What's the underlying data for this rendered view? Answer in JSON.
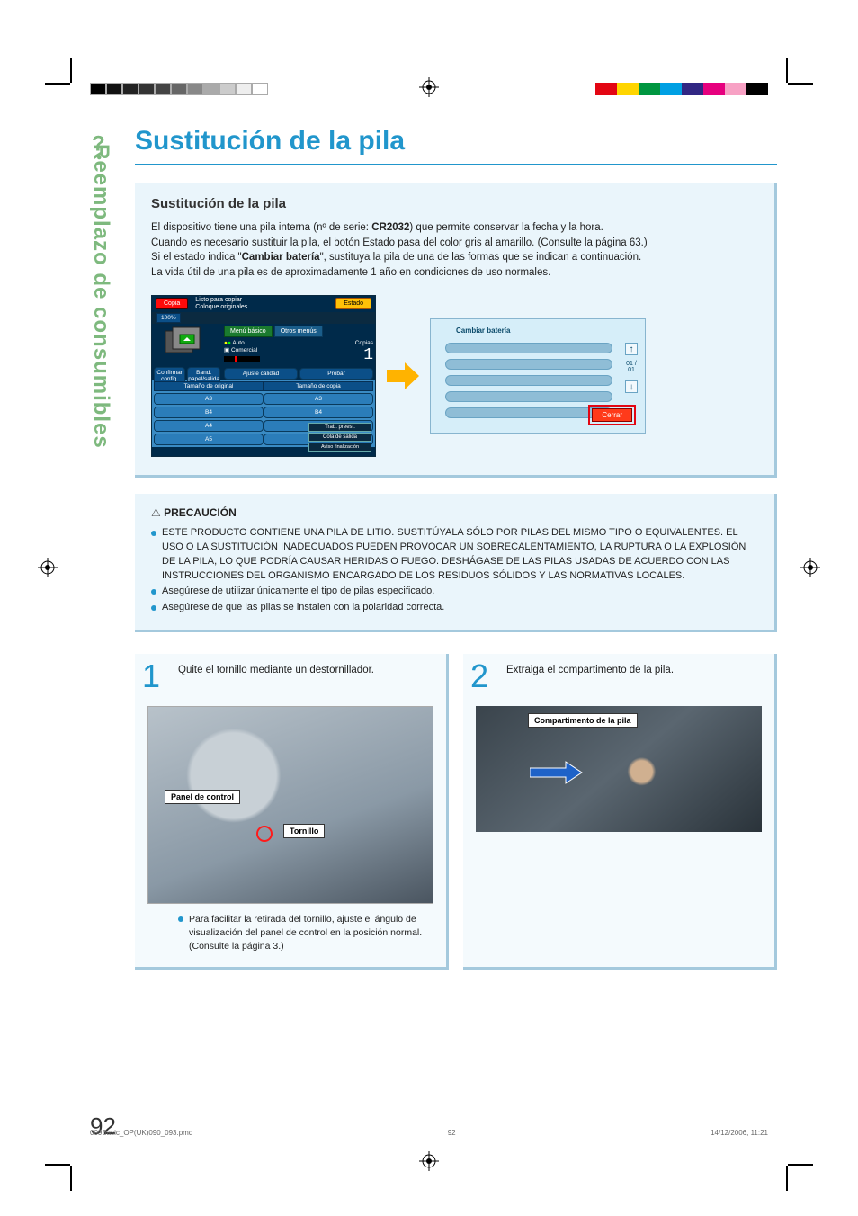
{
  "sidebar_label": "Reemplazo de consumibles",
  "title": "Sustitución de la pila",
  "section_heading": "Sustitución de la pila",
  "intro_line1_a": "El dispositivo tiene una pila interna (nº de serie: ",
  "intro_line1_bold": "CR2032",
  "intro_line1_b": ") que permite conservar la fecha y la hora.",
  "intro_line2": "Cuando es necesario sustituir la pila, el botón Estado pasa del color gris al amarillo. (Consulte la página 63.)",
  "intro_line3_a": "Si el estado indica \"",
  "intro_line3_bold": "Cambiar batería",
  "intro_line3_b": "\", sustituya la pila de una de las formas que se indican a continuación.",
  "intro_line4": "La vida útil de una pila es de aproximadamente 1 año en condiciones de uso normales.",
  "screenA": {
    "mode": "Copia",
    "ready": "Listo para copiar",
    "place": "Coloque originales",
    "estado": "Estado",
    "zoom": "100%",
    "confirm": "Confirmar config.",
    "bandeja": "Band. papel/salida",
    "orig_head": "Tamaño de original",
    "copy_head": "Tamaño de copia",
    "sizes": [
      "A3",
      "B4",
      "A4",
      "A5"
    ],
    "tab_menu": "Menú básico",
    "tab_menu2": "Otros menús",
    "auto": "Auto",
    "comercial": "Comercial",
    "copias": "Copias",
    "count": "1",
    "ajuste": "Ajuste calidad",
    "probar": "Probar",
    "trab": "Trab. preest.",
    "cola": "Cola de salida",
    "aviso": "Aviso finalización"
  },
  "screenB": {
    "header": "Cambiar batería",
    "counter": "01 / 01",
    "cerrar": "Cerrar"
  },
  "caution_heading": "PRECAUCIÓN",
  "caution_items": [
    "ESTE PRODUCTO CONTIENE UNA PILA DE LITIO. SUSTITÚYALA SÓLO POR PILAS DEL MISMO TIPO O EQUIVALENTES. EL USO O LA SUSTITUCIÓN INADECUADOS PUEDEN PROVOCAR UN SOBRECALENTAMIENTO, LA RUPTURA O LA EXPLOSIÓN DE LA PILA, LO QUE PODRÍA CAUSAR HERIDAS O FUEGO. DESHÁGASE DE LAS PILAS USADAS DE ACUERDO CON LAS INSTRUCCIONES DEL ORGANISMO ENCARGADO DE LOS RESIDUOS SÓLIDOS Y LAS NORMATIVAS LOCALES.",
    "Asegúrese de utilizar únicamente el tipo de pilas especificado.",
    "Asegúrese de que las pilas se instalen con la polaridad correcta."
  ],
  "step1_num": "1",
  "step1_text": "Quite el tornillo mediante un destornillador.",
  "step1_label_panel": "Panel de control",
  "step1_label_screw": "Tornillo",
  "step1_note": "Para facilitar la retirada del tornillo, ajuste el ángulo de visualización del panel de control en la posición normal. (Consulte la página 3.)",
  "step2_num": "2",
  "step2_text": "Extraiga el compartimento de la pila.",
  "step2_label": "Compartimento de la pila",
  "page_number": "92",
  "footer_file": "009Basic_OP(UK)090_093.pmd",
  "footer_page": "92",
  "footer_date": "14/12/2006, 11:21"
}
